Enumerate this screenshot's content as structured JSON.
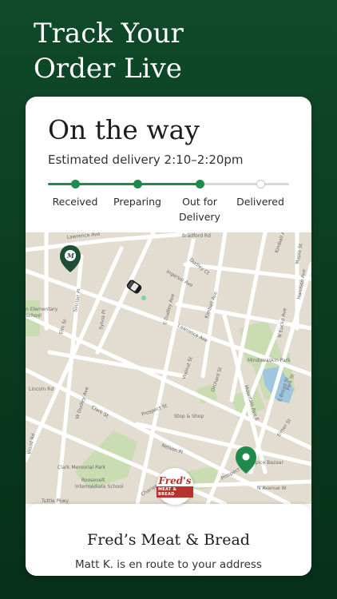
{
  "promo": {
    "title_line1": "Track Your",
    "title_line2": "Order Live"
  },
  "order": {
    "status": "On the way",
    "eta": "Estimated delivery 2:10–2:20pm",
    "steps": [
      {
        "label": "Received",
        "done": true
      },
      {
        "label": "Preparing",
        "done": true
      },
      {
        "label_line1": "Out for",
        "label_line2": "Delivery",
        "done": true
      },
      {
        "label": "Delivered",
        "done": false
      }
    ]
  },
  "map": {
    "streets": [
      "Lawrence Ave",
      "Bradford Rd",
      "Dudley Ct",
      "Ingersol Ave",
      "Sinclair Pl",
      "Elm St",
      "Sylvia Pl",
      "Lincoln Rd",
      "E Dudley Ave",
      "Dudley Ave",
      "Walnut St",
      "Orchard St",
      "Kimball Ave",
      "Mountain Ave E",
      "E Broad St",
      "Prospect St",
      "N Avenue W",
      "Clark St",
      "Charles St",
      "Nelson Pl",
      "Elmer St",
      "Harrison Ave",
      "N Euclid Ave",
      "Tuttle Pkwy",
      "Maple St",
      "Park St",
      "Wood Rd",
      "Kimball Ave"
    ],
    "places": [
      "Stop & Shop",
      "Mindowaskin Park",
      "Clark Memorial Park",
      "Roosevelt Intermediate School",
      "Lincoln Elementary School",
      "Spice Bazaar"
    ]
  },
  "store": {
    "name": "Fred’s Meat & Bread",
    "logo_script": "Fred's",
    "logo_sub": "MEAT & BREAD",
    "driver_message": "Matt K. is en route to your address"
  },
  "colors": {
    "accent": "#1f8a4c",
    "background": "#0b3d22",
    "pin": "#1e6b3f",
    "logo_red": "#b5332a"
  }
}
